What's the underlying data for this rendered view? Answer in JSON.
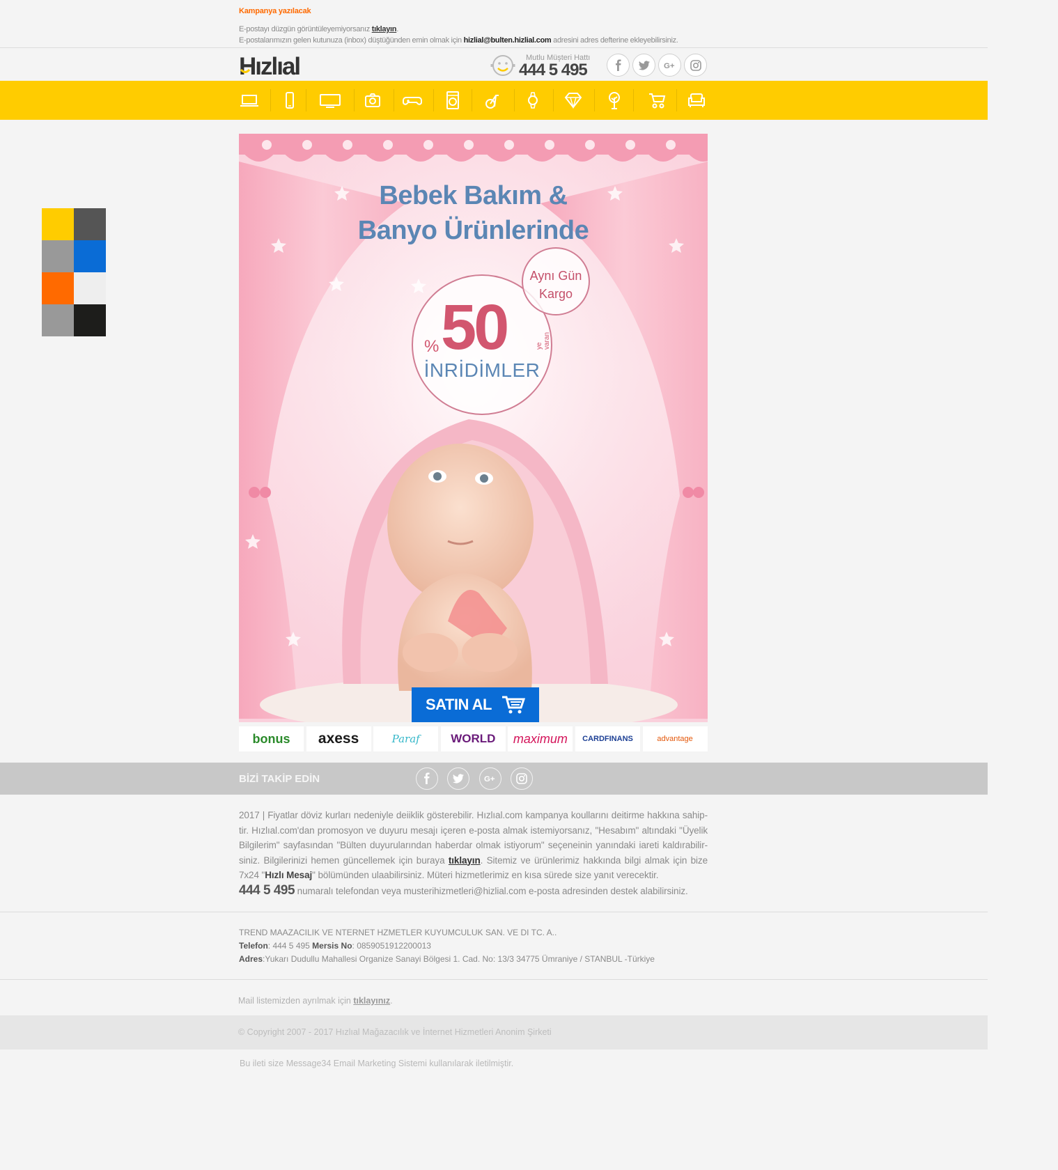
{
  "preheader": {
    "campaign_label": "Kampanya yazılacak",
    "line1_text": "E-postayı düzgün görüntüleyemiyorsanız ",
    "line1_link": "tıklayın",
    "line1_end": ".",
    "line2_text": "E-postalarımızın gelen kutunuza (inbox) düştüğünden emin olmak için ",
    "line2_email": "hizlial@bulten.hizlial.com",
    "line2_end": " adresini adres defterine ekleyebilirsiniz."
  },
  "header": {
    "logo_text": "Hızlıal",
    "hotline_caption": "Mutlu Müşteri Hattı",
    "hotline_number": "444 5 495",
    "social": [
      "facebook-icon",
      "twitter-icon",
      "google-plus-icon",
      "instagram-icon"
    ]
  },
  "nav": {
    "icons": [
      "laptop-icon",
      "phone-icon",
      "tv-icon",
      "camera-icon",
      "gamepad-icon",
      "washing-machine-icon",
      "fitness-icon",
      "watch-icon",
      "diamond-icon",
      "plant-icon",
      "stroller-icon",
      "sofa-icon"
    ]
  },
  "swatches": [
    "#ffcc00",
    "#555555",
    "#999999",
    "#0a6cd6",
    "#ff6a00",
    "#eeeeee",
    "#999999",
    "#1d1d1b"
  ],
  "banner": {
    "title_line1": "Bebek Bakım &",
    "title_line2": "Banyo Ürünlerinde",
    "badge_percent": "%",
    "badge_value": "50",
    "badge_suffix": "ye varan",
    "badge_label": "İNRİDİMLER",
    "kargo_line1": "Aynı Gün",
    "kargo_line2": "Kargo",
    "buy_label": "SATIN AL"
  },
  "cards": [
    {
      "name": "bonus",
      "label": "bonus",
      "color": "#2a8a2a"
    },
    {
      "name": "axess",
      "label": "axess",
      "color": "#1a1a1a"
    },
    {
      "name": "paraf",
      "label": "Paraf",
      "color": "#35b7c9"
    },
    {
      "name": "world",
      "label": "WORLD",
      "color": "#6a1b7a"
    },
    {
      "name": "maximum",
      "label": "maximum",
      "color": "#d4145a"
    },
    {
      "name": "cardfinans",
      "label": "CARDFINANS",
      "color": "#1c3f94"
    },
    {
      "name": "advantage",
      "label": "advantage",
      "color": "#e4580b"
    }
  ],
  "follow": {
    "label": "BİZİ TAKİP EDİN"
  },
  "disclaimer": {
    "p1": "2017 | Fiyatlar döviz kurları nedeniyle deiiklik gösterebilir. Hızlıal.com kampanya koullarını deitirme hakkına sahip-tir. Hızlıal.com'dan promosyon ve duyuru mesajı içeren e-posta almak istemiyorsanız, \"Hesabım\" altındaki \"Üyelik Bilgilerim\" sayfasından \"Bülten duyurularından haberdar olmak istiyorum\" seçeneinin yanındaki iareti kaldırabilir-siniz. Bilgilerinizi hemen güncellemek için buraya ",
    "p1_link": "tıklayın",
    "p2": ". Sitemiz ve ürünlerimiz hakkında bilgi almak için bize 7x24 \"",
    "p2_bold": "Hızlı Mesaj",
    "p3": "\" bölümünden ulaabilirsiniz. Müteri hizmetlerimiz en kısa sürede size yanıt verecektir.",
    "phone": "444 5 495",
    "p4": " numaralı telefondan veya musterihizmetleri@hizlial.com e-posta adresinden destek alabilirsiniz."
  },
  "company": {
    "name": "TREND MAAZACILIK VE NTERNET HZMETLER KUYUMCULUK SAN. VE DI TC. A..",
    "phone_label": "Telefon",
    "phone_value": ": 444 5 495 ",
    "mersis_label": "Mersis No",
    "mersis_value": ": 0859051912200013",
    "address_label": "Adres",
    "address_value": ":Yukarı Dudullu Mahallesi Organize Sanayi Bölgesi 1. Cad. No: 13/3 34775 Ümraniye / STANBUL -Türkiye"
  },
  "unsubscribe": {
    "text": "Mail listemizden ayrılmak için ",
    "link": "tıklayınız",
    "end": "."
  },
  "copyright": "© Copyright 2007 - 2017 Hızlıal Mağazacılık ve İnternet Hizmetleri Anonim Şirketi",
  "sent_by": "Bu ileti size Message34 Email Marketing Sistemi kullanılarak iletilmiştir."
}
